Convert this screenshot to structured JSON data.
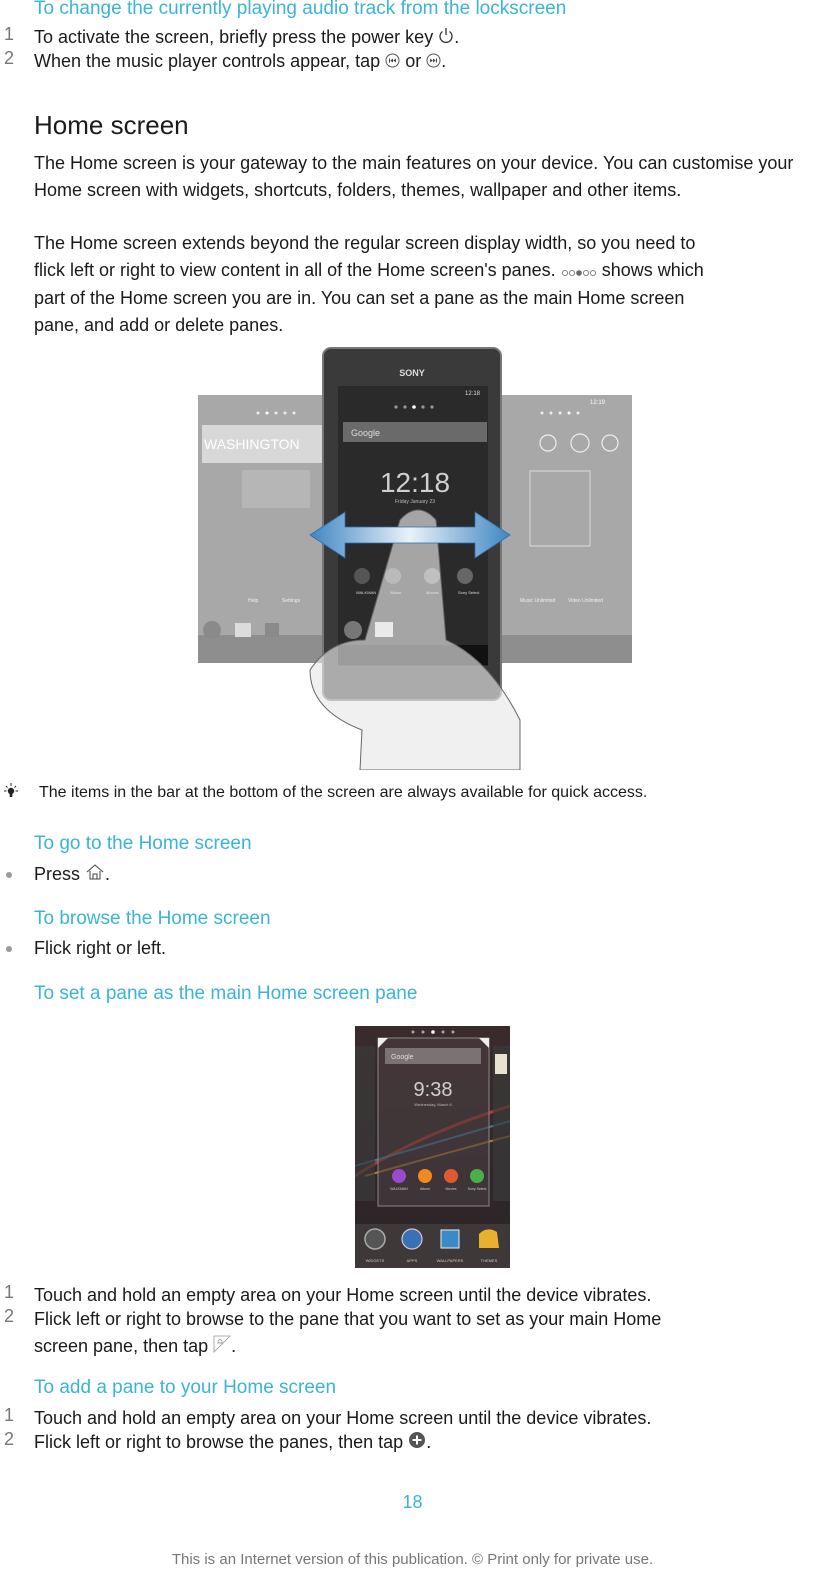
{
  "section_lockscreen": {
    "heading": "To change the currently playing audio track from the lockscreen",
    "steps": [
      {
        "num": "1",
        "text_before": "To activate the screen, briefly press the power key ",
        "icon": "power-icon",
        "text_after": "."
      },
      {
        "num": "2",
        "text_before": "When the music player controls appear, tap ",
        "icon1": "previous-track-icon",
        "middle": " or ",
        "icon2": "next-track-icon",
        "text_after": "."
      }
    ]
  },
  "home_screen": {
    "title": "Home screen",
    "para1": "The Home screen is your gateway to the main features on your device. You can customise your Home screen with widgets, shortcuts, folders, themes, wallpaper and other items.",
    "para2_lines": [
      "The Home screen extends beyond the regular screen display width, so you need to",
      "flick left or right to view content in all of the Home screen's panes.",
      "shows which",
      "part of the Home screen you are in. You can set a pane as the main Home screen",
      "pane, and add or delete panes."
    ],
    "pane_indicator_icon": "pane-indicator-icon"
  },
  "illustration_phone": {
    "brand": "SONY",
    "status_time_center": "12:18",
    "status_time_right": "12:19",
    "search_label": "Google",
    "clock": "12:18",
    "date": "Friday January 23",
    "left_widget": "WASHINGTON",
    "apps_center": [
      "WALKMAN",
      "Album",
      "Movies",
      "Sony Select"
    ],
    "apps_left": [
      "Help",
      "Settings"
    ],
    "apps_right": [
      "Music Unlimited",
      "Video Unlimited"
    ]
  },
  "tip": {
    "icon": "lightbulb-icon",
    "text": "The items in the bar at the bottom of the screen are always available for quick access."
  },
  "section_go_home": {
    "heading": "To go to the Home screen",
    "bullet_before": "Press ",
    "icon": "home-icon",
    "bullet_after": "."
  },
  "section_browse": {
    "heading": "To browse the Home screen",
    "bullet": "Flick right or left."
  },
  "section_set_main": {
    "heading": "To set a pane as the main Home screen pane",
    "phone": {
      "search_label": "Google",
      "clock": "9:38",
      "date": "Wednesday, March 6",
      "apps": [
        "WALKMAN",
        "Album",
        "Movies",
        "Sony Select"
      ],
      "dock": [
        "WIDGETS",
        "APPS",
        "WALLPAPERS",
        "THEMES"
      ]
    },
    "steps": [
      {
        "num": "1",
        "text": "Touch and hold an empty area on your Home screen until the device vibrates."
      },
      {
        "num": "2",
        "line1": "Flick left or right to browse to the pane that you want to set as your main Home",
        "line2_before": "screen pane, then tap ",
        "icon": "set-main-pane-icon",
        "line2_after": "."
      }
    ]
  },
  "section_add_pane": {
    "heading": "To add a pane to your Home screen",
    "steps": [
      {
        "num": "1",
        "text": "Touch and hold an empty area on your Home screen until the device vibrates."
      },
      {
        "num": "2",
        "text_before": "Flick left or right to browse the panes, then tap ",
        "icon": "add-pane-icon",
        "text_after": "."
      }
    ]
  },
  "footer": {
    "page_number": "18",
    "note": "This is an Internet version of this publication. © Print only for private use."
  },
  "colors": {
    "heading_blue": "#3bb4d8",
    "body_text": "#1a1a1a",
    "muted": "#777777",
    "arrow_blue": "#4a90c8"
  }
}
